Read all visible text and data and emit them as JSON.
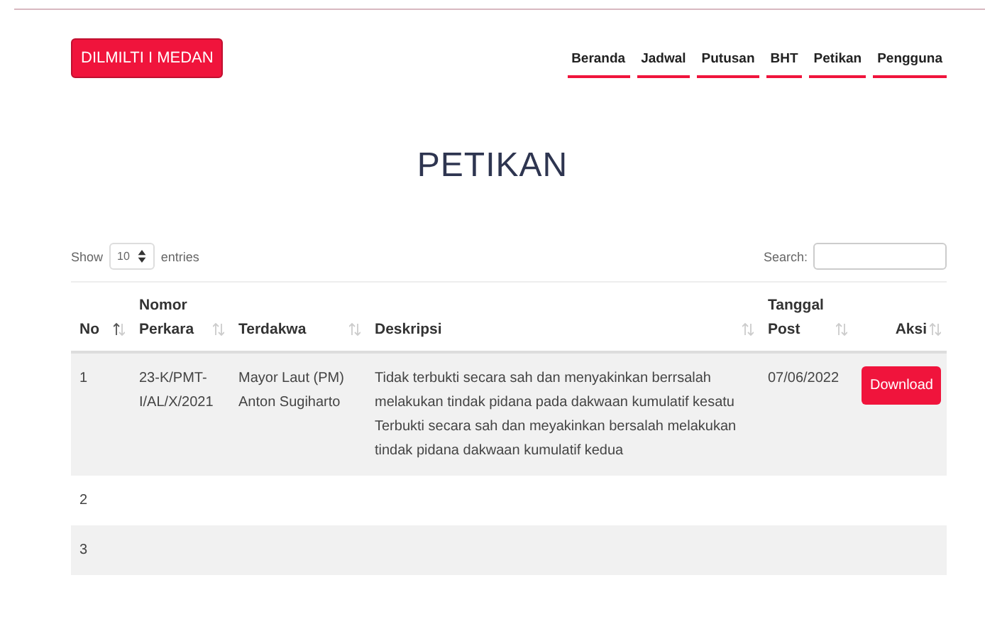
{
  "brand": "DILMILTI I MEDAN",
  "nav": [
    {
      "label": "Beranda"
    },
    {
      "label": "Jadwal"
    },
    {
      "label": "Putusan"
    },
    {
      "label": "BHT"
    },
    {
      "label": "Petikan"
    },
    {
      "label": "Pengguna"
    }
  ],
  "title": "PETIKAN",
  "length": {
    "before": "Show",
    "value": "10",
    "after": "entries"
  },
  "search": {
    "label": "Search:"
  },
  "table": {
    "columns": [
      {
        "label": "No",
        "sorted": true
      },
      {
        "label": "Nomor Perkara",
        "sorted": false
      },
      {
        "label": "Terdakwa",
        "sorted": false
      },
      {
        "label": "Deskripsi",
        "sorted": false
      },
      {
        "label": "Tanggal Post",
        "sorted": false
      },
      {
        "label": "Aksi",
        "sorted": false
      }
    ],
    "rows": [
      {
        "no": "1",
        "nomor": "23-K/PMT-I/AL/X/2021",
        "terdakwa": "Mayor Laut (PM) Anton Sugiharto",
        "deskripsi": "Tidak terbukti secara sah dan menyakinkan berrsalah melakukan tindak pidana pada dakwaan kumulatif kesatu Terbukti secara sah dan meyakinkan bersalah melakukan tindak pidana dakwaan kumulatif kedua",
        "tanggal": "07/06/2022",
        "action": "Download"
      },
      {
        "no": "2"
      },
      {
        "no": "3"
      }
    ]
  }
}
